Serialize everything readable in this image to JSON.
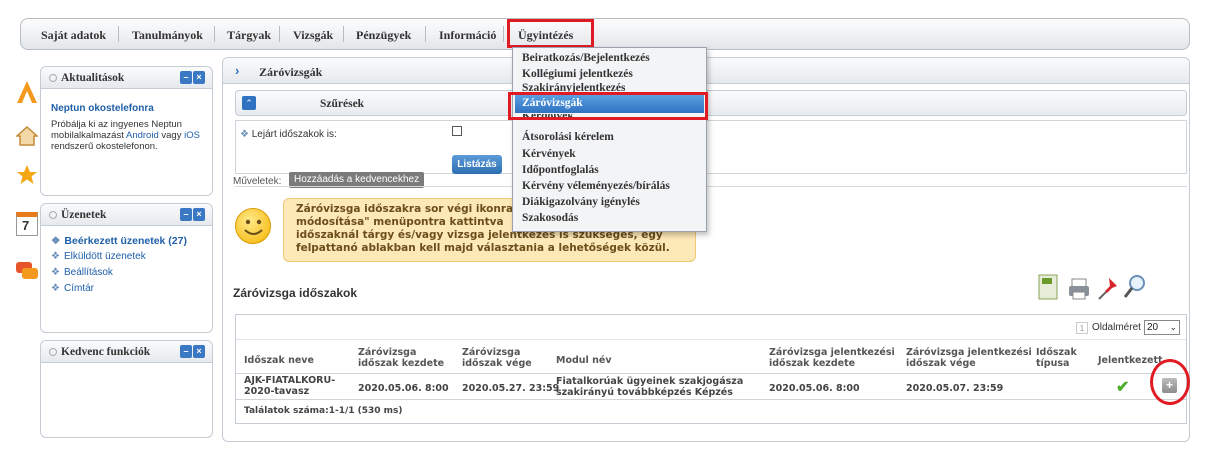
{
  "nav": {
    "items": [
      "Saját adatok",
      "Tanulmányok",
      "Tárgyak",
      "Vizsgák",
      "Pénzügyek",
      "Információ",
      "Ügyintézés"
    ],
    "active": "Ügyintézés"
  },
  "icons": [
    "award-icon",
    "home-icon",
    "star-icon",
    "calendar-icon",
    "chat-icon"
  ],
  "calendar_day": "7",
  "news": {
    "title": "Aktualitások",
    "headline": "Neptun okostelefonra",
    "text_a": "Próbálja ki az ingyenes Neptun mobilalkalmazást ",
    "link_android": "Android",
    "text_b": " vagy ",
    "link_ios": "iOS",
    "text_c": " rendszerű okostelefonon."
  },
  "messages": {
    "title": "Üzenetek",
    "items": [
      "Beérkezett üzenetek (27)",
      "Elküldött üzenetek",
      "Beállítások",
      "Címtár"
    ]
  },
  "favorites": {
    "title": "Kedvenc funkciók"
  },
  "main": {
    "title": "Záróvizsgák",
    "filter_title": "Szűrések",
    "filter_label": "Lejárt időszakok is:",
    "list_button": "Listázás",
    "ops_label": "Műveletek:",
    "fav_button": "Hozzáadás a kedvencekhez",
    "info_l1": "Záróvizsga időszakra sor végi ikonra, m",
    "info_l2": "módosítása\" menüpontra kattintva",
    "info_l3": "időszaknál tárgy és/vagy vizsga jelentkezés is szükséges, egy",
    "info_l4": "felpattanó ablakban kell majd választania a lehetőségek közül.",
    "section_title": "Záróvizsga időszakok"
  },
  "table": {
    "page_size_label": "Oldalméret",
    "page_size": "20",
    "page_indicator": "1",
    "headers": [
      "Időszak neve",
      "Záróvizsga időszak kezdete",
      "Záróvizsga időszak vége",
      "Modul név",
      "Záróvizsga jelentkezési időszak kezdete",
      "Záróvizsga jelentkezési időszak vége",
      "Időszak típusa",
      "Jelentkezett"
    ],
    "row": {
      "name": "AJK-FIATALKORU-2020-tavasz",
      "start": "2020.05.06. 8:00",
      "end": "2020.05.27. 23:59",
      "module": "Fiatalkorúak ügyeinek szakjogásza szakirányú továbbképzés Képzés",
      "app_start": "2020.05.06. 8:00",
      "app_end": "2020.05.07. 23:59",
      "type": "",
      "applied": "✔"
    },
    "footer": "Találatok száma:1-1/1 (530 ms)"
  },
  "dropdown": {
    "items": [
      "Beiratkozás/Bejelentkezés",
      "Kollégiumi jelentkezés",
      "Szakirányjelentkezés",
      "Záróvizsgák",
      "Kérdőívek",
      "Átsorolási kérelem",
      "Kérvények",
      "Időpontfoglalás",
      "Kérvény véleményezés/bírálás",
      "Diákigazolvány igénylés",
      "Szakosodás"
    ],
    "active": "Záróvizsgák"
  },
  "colors": {
    "highlight": "#e01b24",
    "link": "#1f5fa8",
    "menu_active": "#2f72c2",
    "info_bg": "#fde8b8"
  }
}
